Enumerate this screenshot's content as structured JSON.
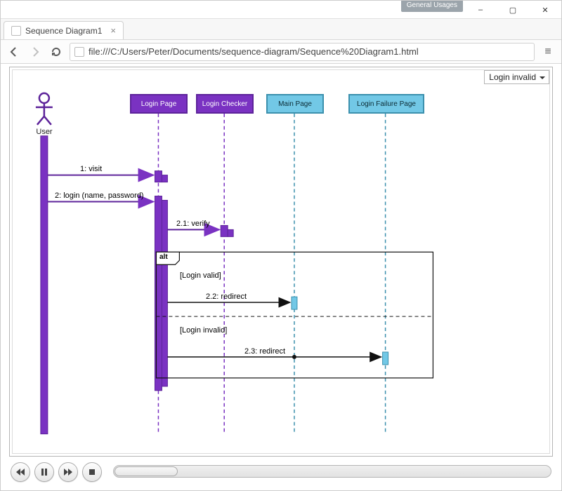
{
  "window": {
    "tag": "General Usages",
    "minimize": "–",
    "maximize": "▢",
    "close": "✕"
  },
  "tab": {
    "title": "Sequence Diagram1"
  },
  "addressbar": {
    "url": "file:///C:/Users/Peter/Documents/sequence-diagram/Sequence%20Diagram1.html"
  },
  "panel": {
    "selected": "Login invalid"
  },
  "diagram": {
    "actor": "User",
    "lifelines": {
      "login_page": "Login Page",
      "login_checker": "Login Checker",
      "main_page": "Main Page",
      "login_failure": "Login Failure Page"
    },
    "messages": {
      "m1": "1: visit",
      "m2": "2: login (name, password)",
      "m21": "2.1: verify",
      "m22": "2.2: redirect",
      "m23": "2.3: redirect"
    },
    "fragment": {
      "operator": "alt",
      "guard_valid": "[Login valid]",
      "guard_invalid": "[Login invalid]"
    }
  }
}
